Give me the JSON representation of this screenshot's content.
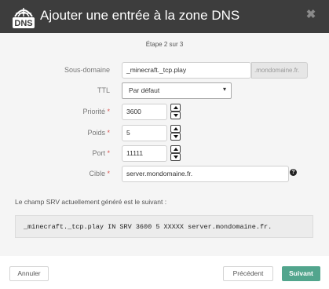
{
  "dialog": {
    "title": "Ajouter une entrée à la zone DNS",
    "logo_text": "DNS",
    "close_icon": "close-icon"
  },
  "step": "Étape 2 sur 3",
  "form": {
    "subdomain": {
      "label": "Sous-domaine",
      "value": "_minecraft._tcp.play",
      "suffix": ".mondomaine.fr."
    },
    "ttl": {
      "label": "TTL",
      "value": "Par défaut"
    },
    "priority": {
      "label": "Priorité",
      "required": "*",
      "value": "3600"
    },
    "weight": {
      "label": "Poids",
      "required": "*",
      "value": "5"
    },
    "port": {
      "label": "Port",
      "required": "*",
      "value": "11111"
    },
    "target": {
      "label": "Cible",
      "required": "*",
      "value": "server.mondomaine.fr.",
      "help": "?"
    }
  },
  "srv": {
    "label": "Le champ SRV actuellement généré est le suivant :",
    "value": "_minecraft._tcp.play IN SRV 3600 5 XXXXX server.mondomaine.fr."
  },
  "footer": {
    "cancel": "Annuler",
    "previous": "Précédent",
    "next": "Suivant"
  },
  "colors": {
    "header": "#3d3d3d",
    "primary": "#52a58d",
    "required": "#d9534f"
  }
}
